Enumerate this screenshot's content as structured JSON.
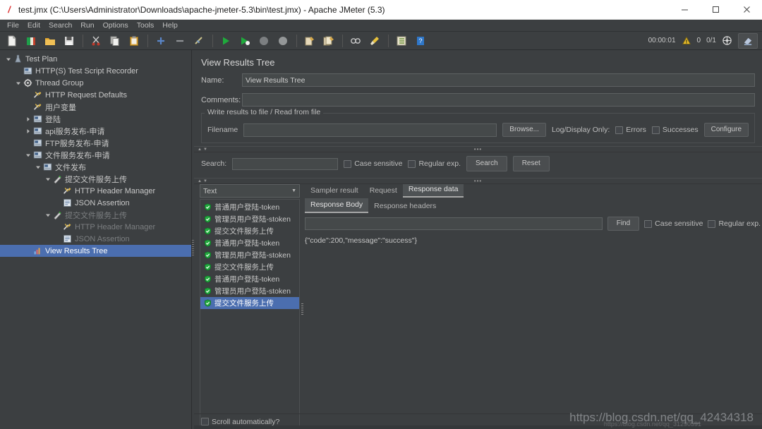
{
  "window": {
    "title": "test.jmx (C:\\Users\\Administrator\\Downloads\\apache-jmeter-5.3\\bin\\test.jmx) - Apache JMeter (5.3)",
    "app_icon": "jmeter-feather-icon",
    "minimize": "minimize-icon",
    "maximize": "maximize-icon",
    "close": "close-icon"
  },
  "menubar": {
    "items": [
      "File",
      "Edit",
      "Search",
      "Run",
      "Options",
      "Tools",
      "Help"
    ]
  },
  "toolbar": {
    "icons": [
      "new-icon",
      "templates-icon",
      "open-icon",
      "save-icon",
      "cut-icon",
      "copy-icon",
      "paste-icon",
      "expand-all-icon",
      "collapse-all-icon",
      "toggle-icon",
      "start-icon",
      "start-no-pauses-icon",
      "stop-icon",
      "shutdown-icon",
      "clear-icon",
      "clear-all-icon",
      "search-icon",
      "search-reset-icon",
      "function-helper-icon",
      "help-icon"
    ],
    "elapsed_time": "00:00:01",
    "warning_icon": "warning-triangle-icon",
    "warning_count": "0",
    "thread_counter": "0/1",
    "remote_icon": "remote-engine-icon",
    "dark_mode_icon": "theme-toggle-icon"
  },
  "tree": {
    "nodes": [
      {
        "label": "Test Plan",
        "indent": 0,
        "toggle": "down",
        "icon": "test-plan-icon",
        "dim": false,
        "selected": false
      },
      {
        "label": "HTTP(S) Test Script Recorder",
        "indent": 1,
        "toggle": "none",
        "icon": "recorder-icon",
        "dim": false,
        "selected": false
      },
      {
        "label": "Thread Group",
        "indent": 1,
        "toggle": "down",
        "icon": "thread-group-icon",
        "dim": false,
        "selected": false
      },
      {
        "label": "HTTP Request Defaults",
        "indent": 2,
        "toggle": "none",
        "icon": "config-element-icon",
        "dim": false,
        "selected": false
      },
      {
        "label": "用户变量",
        "indent": 2,
        "toggle": "none",
        "icon": "config-element-icon",
        "dim": false,
        "selected": false
      },
      {
        "label": "登陆",
        "indent": 2,
        "toggle": "right",
        "icon": "controller-icon",
        "dim": false,
        "selected": false
      },
      {
        "label": "api服务发布-申请",
        "indent": 2,
        "toggle": "right",
        "icon": "controller-icon",
        "dim": false,
        "selected": false
      },
      {
        "label": "FTP服务发布-申请",
        "indent": 2,
        "toggle": "none",
        "icon": "controller-icon",
        "dim": false,
        "selected": false
      },
      {
        "label": "文件服务发布-申请",
        "indent": 2,
        "toggle": "down",
        "icon": "controller-icon",
        "dim": false,
        "selected": false
      },
      {
        "label": "文件发布",
        "indent": 3,
        "toggle": "down",
        "icon": "controller-icon",
        "dim": false,
        "selected": false
      },
      {
        "label": "提交文件服务上传",
        "indent": 4,
        "toggle": "down",
        "icon": "http-sampler-icon",
        "dim": false,
        "selected": false
      },
      {
        "label": "HTTP Header Manager",
        "indent": 5,
        "toggle": "none",
        "icon": "config-element-icon",
        "dim": false,
        "selected": false
      },
      {
        "label": "JSON Assertion",
        "indent": 5,
        "toggle": "none",
        "icon": "assertion-icon",
        "dim": false,
        "selected": false
      },
      {
        "label": "提交文件服务上传",
        "indent": 4,
        "toggle": "down",
        "icon": "http-sampler-icon",
        "dim": true,
        "selected": false
      },
      {
        "label": "HTTP Header Manager",
        "indent": 5,
        "toggle": "none",
        "icon": "config-element-icon",
        "dim": true,
        "selected": false
      },
      {
        "label": "JSON Assertion",
        "indent": 5,
        "toggle": "none",
        "icon": "assertion-icon",
        "dim": true,
        "selected": false
      },
      {
        "label": "View Results Tree",
        "indent": 2,
        "toggle": "none",
        "icon": "view-results-tree-icon",
        "dim": false,
        "selected": true
      }
    ]
  },
  "panel": {
    "title": "View Results Tree",
    "name_label": "Name:",
    "name_value": "View Results Tree",
    "comments_label": "Comments:",
    "comments_value": "",
    "file_group_legend": "Write results to file / Read from file",
    "filename_label": "Filename",
    "filename_value": "",
    "browse_button": "Browse...",
    "log_display_label": "Log/Display Only:",
    "errors_checkbox": "Errors",
    "successes_checkbox": "Successes",
    "configure_button": "Configure"
  },
  "search_bar": {
    "label": "Search:",
    "value": "",
    "case_sensitive": "Case sensitive",
    "regular_exp": "Regular exp.",
    "search_button": "Search",
    "reset_button": "Reset"
  },
  "results": {
    "renderer_selected": "Text",
    "items": [
      {
        "label": "普通用户登陆-token",
        "status": "success",
        "selected": false
      },
      {
        "label": "管理员用户登陆-stoken",
        "status": "success",
        "selected": false
      },
      {
        "label": "提交文件服务上传",
        "status": "success",
        "selected": false
      },
      {
        "label": "普通用户登陆-token",
        "status": "success",
        "selected": false
      },
      {
        "label": "管理员用户登陆-stoken",
        "status": "success",
        "selected": false
      },
      {
        "label": "提交文件服务上传",
        "status": "success",
        "selected": false
      },
      {
        "label": "普通用户登陆-token",
        "status": "success",
        "selected": false
      },
      {
        "label": "管理员用户登陆-stoken",
        "status": "success",
        "selected": false
      },
      {
        "label": "提交文件服务上传",
        "status": "success",
        "selected": true
      }
    ],
    "scroll_automatically": "Scroll automatically?"
  },
  "detail_tabs": {
    "primary": [
      {
        "label": "Sampler result",
        "active": false
      },
      {
        "label": "Request",
        "active": false
      },
      {
        "label": "Response data",
        "active": true
      }
    ],
    "secondary": [
      {
        "label": "Response Body",
        "active": true
      },
      {
        "label": "Response headers",
        "active": false
      }
    ],
    "find_value": "",
    "find_button": "Find",
    "case_sensitive": "Case sensitive",
    "regular_exp": "Regular exp.",
    "response_body": "{\"code\":200,\"message\":\"success\"}"
  },
  "watermark": {
    "primary": "https://blog.csdn.net/qq_42434318",
    "secondary": "https://blog.csdn.net/qq_31290591"
  },
  "colors": {
    "bg": "#3c3f41",
    "selection": "#4b6eaf",
    "success_green": "#2eb82e",
    "text": "#c8c8c8"
  }
}
